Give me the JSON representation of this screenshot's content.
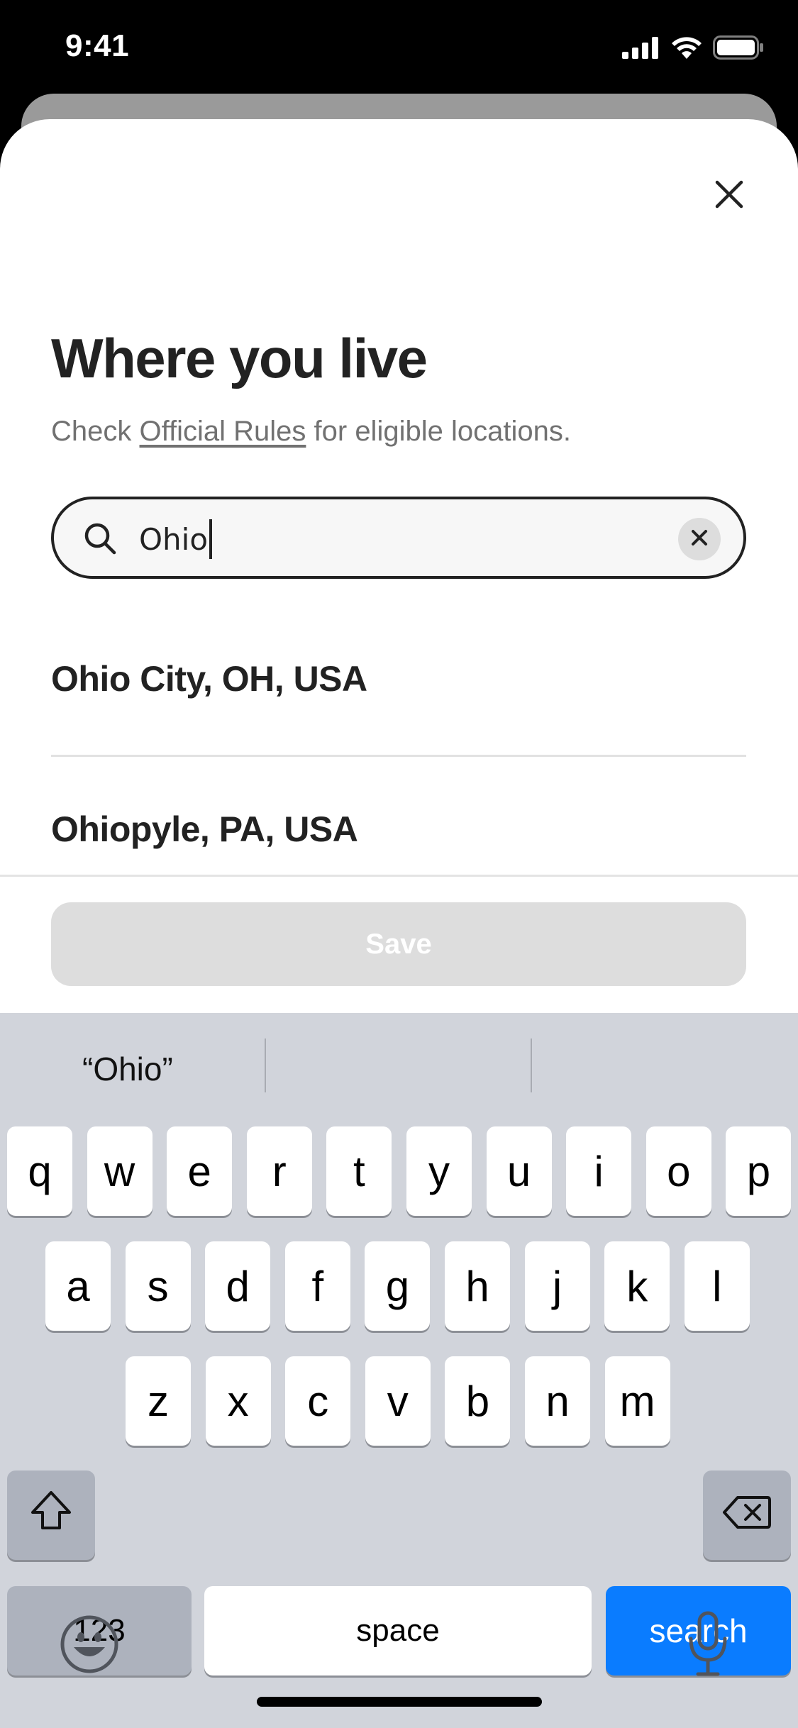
{
  "status_bar": {
    "time": "9:41",
    "icons": [
      "cellular-signal-icon",
      "wifi-icon",
      "battery-icon"
    ]
  },
  "sheet": {
    "close_icon": "close-icon",
    "title": "Where you live",
    "subtitle_prefix": "Check ",
    "subtitle_link": "Official Rules",
    "subtitle_suffix": " for eligible locations.",
    "search": {
      "value": "Ohio",
      "search_icon": "search-icon",
      "clear_icon": "clear-icon"
    },
    "results": [
      {
        "label": "Ohio City, OH, USA"
      },
      {
        "label": "Ohiopyle, PA, USA"
      }
    ],
    "save_label": "Save"
  },
  "keyboard": {
    "suggestions": [
      "“Ohio”",
      "",
      ""
    ],
    "row1": [
      "q",
      "w",
      "e",
      "r",
      "t",
      "y",
      "u",
      "i",
      "o",
      "p"
    ],
    "row2": [
      "a",
      "s",
      "d",
      "f",
      "g",
      "h",
      "j",
      "k",
      "l"
    ],
    "row3": [
      "z",
      "x",
      "c",
      "v",
      "b",
      "n",
      "m"
    ],
    "numbers_label": "123",
    "space_label": "space",
    "return_label": "search",
    "icons": [
      "shift-icon",
      "delete-icon",
      "emoji-icon",
      "microphone-icon"
    ]
  },
  "colors": {
    "accent_blue": "#0a7cff",
    "text_primary": "#222222",
    "text_secondary": "#717171",
    "disabled_button": "#dddddd",
    "keyboard_bg": "#d1d4db"
  }
}
